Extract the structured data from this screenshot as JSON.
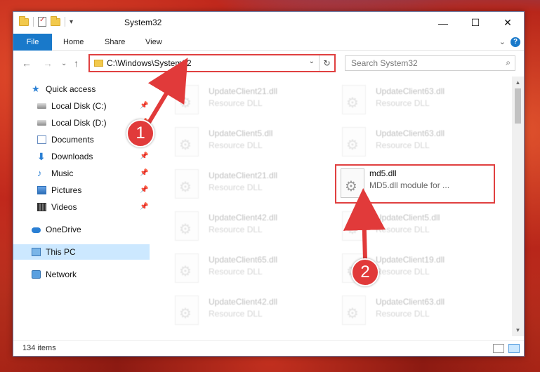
{
  "window": {
    "title": "System32",
    "minimize_glyph": "—",
    "maximize_glyph": "☐",
    "close_glyph": "✕",
    "qat_dropdown_glyph": "▾"
  },
  "ribbon": {
    "tabs": [
      "File",
      "Home",
      "Share",
      "View"
    ],
    "help_glyph": "?",
    "collapse_glyph": "⌄"
  },
  "address": {
    "path": "C:\\Windows\\System32",
    "dropdown_glyph": "⌄",
    "refresh_glyph": "↻",
    "back_glyph": "←",
    "forward_glyph": "→",
    "recent_glyph": "⌄",
    "up_glyph": "↑"
  },
  "search": {
    "placeholder": "Search System32",
    "icon_glyph": "⌕"
  },
  "nav": {
    "items": [
      {
        "label": "Quick access",
        "pinned": false
      },
      {
        "label": "Local Disk (C:)",
        "pinned": true
      },
      {
        "label": "Local Disk (D:)",
        "pinned": true
      },
      {
        "label": "Documents",
        "pinned": true
      },
      {
        "label": "Downloads",
        "pinned": true
      },
      {
        "label": "Music",
        "pinned": true
      },
      {
        "label": "Pictures",
        "pinned": true
      },
      {
        "label": "Videos",
        "pinned": true
      },
      {
        "label": "OneDrive",
        "pinned": false
      },
      {
        "label": "This PC",
        "pinned": false,
        "selected": true
      },
      {
        "label": "Network",
        "pinned": false
      }
    ],
    "pin_glyph": "📌"
  },
  "files": [
    {
      "name": "UpdateClient21.dll",
      "type": "Resource DLL"
    },
    {
      "name": "UpdateClient63.dll",
      "type": "Resource DLL"
    },
    {
      "name": "UpdateClient5.dll",
      "type": "Resource DLL"
    },
    {
      "name": "UpdateClient63.dll",
      "type": "Resource DLL"
    },
    {
      "name": "UpdateClient21.dll",
      "type": "Resource DLL"
    },
    {
      "name": "md5.dll",
      "type": "MD5.dll module for ...",
      "highlighted": true
    },
    {
      "name": "UpdateClient42.dll",
      "type": "Resource DLL"
    },
    {
      "name": "UpdateClient5.dll",
      "type": "Resource DLL"
    },
    {
      "name": "UpdateClient65.dll",
      "type": "Resource DLL"
    },
    {
      "name": "UpdateClient19.dll",
      "type": "Resource DLL"
    },
    {
      "name": "UpdateClient42.dll",
      "type": "Resource DLL"
    },
    {
      "name": "UpdateClient63.dll",
      "type": "Resource DLL"
    }
  ],
  "status": {
    "count": "134 items"
  },
  "scrollbar": {
    "up_glyph": "▲",
    "down_glyph": "▼"
  },
  "callouts": [
    {
      "number": "1",
      "target": "address-bar"
    },
    {
      "number": "2",
      "target": "md5-dll-file"
    }
  ],
  "colors": {
    "accent": "#1979ca",
    "highlight_border": "#e04040",
    "callout": "#e13a3a",
    "selection": "#cce8ff"
  }
}
